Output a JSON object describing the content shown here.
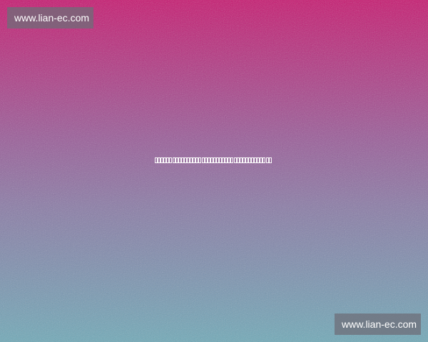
{
  "watermark": {
    "top_text": "www.lian-ec.com",
    "bottom_text": "www.lian-ec.com"
  },
  "colors": {
    "gradient_top": "#c7166f",
    "gradient_mid": "#9a5a98",
    "gradient_bottom": "#6fa9b8",
    "watermark_bg": "#6e6e78",
    "text": "#ffffff"
  },
  "center_glyphs": {
    "description_icon": "missing-glyph-boxes",
    "count": 40
  }
}
